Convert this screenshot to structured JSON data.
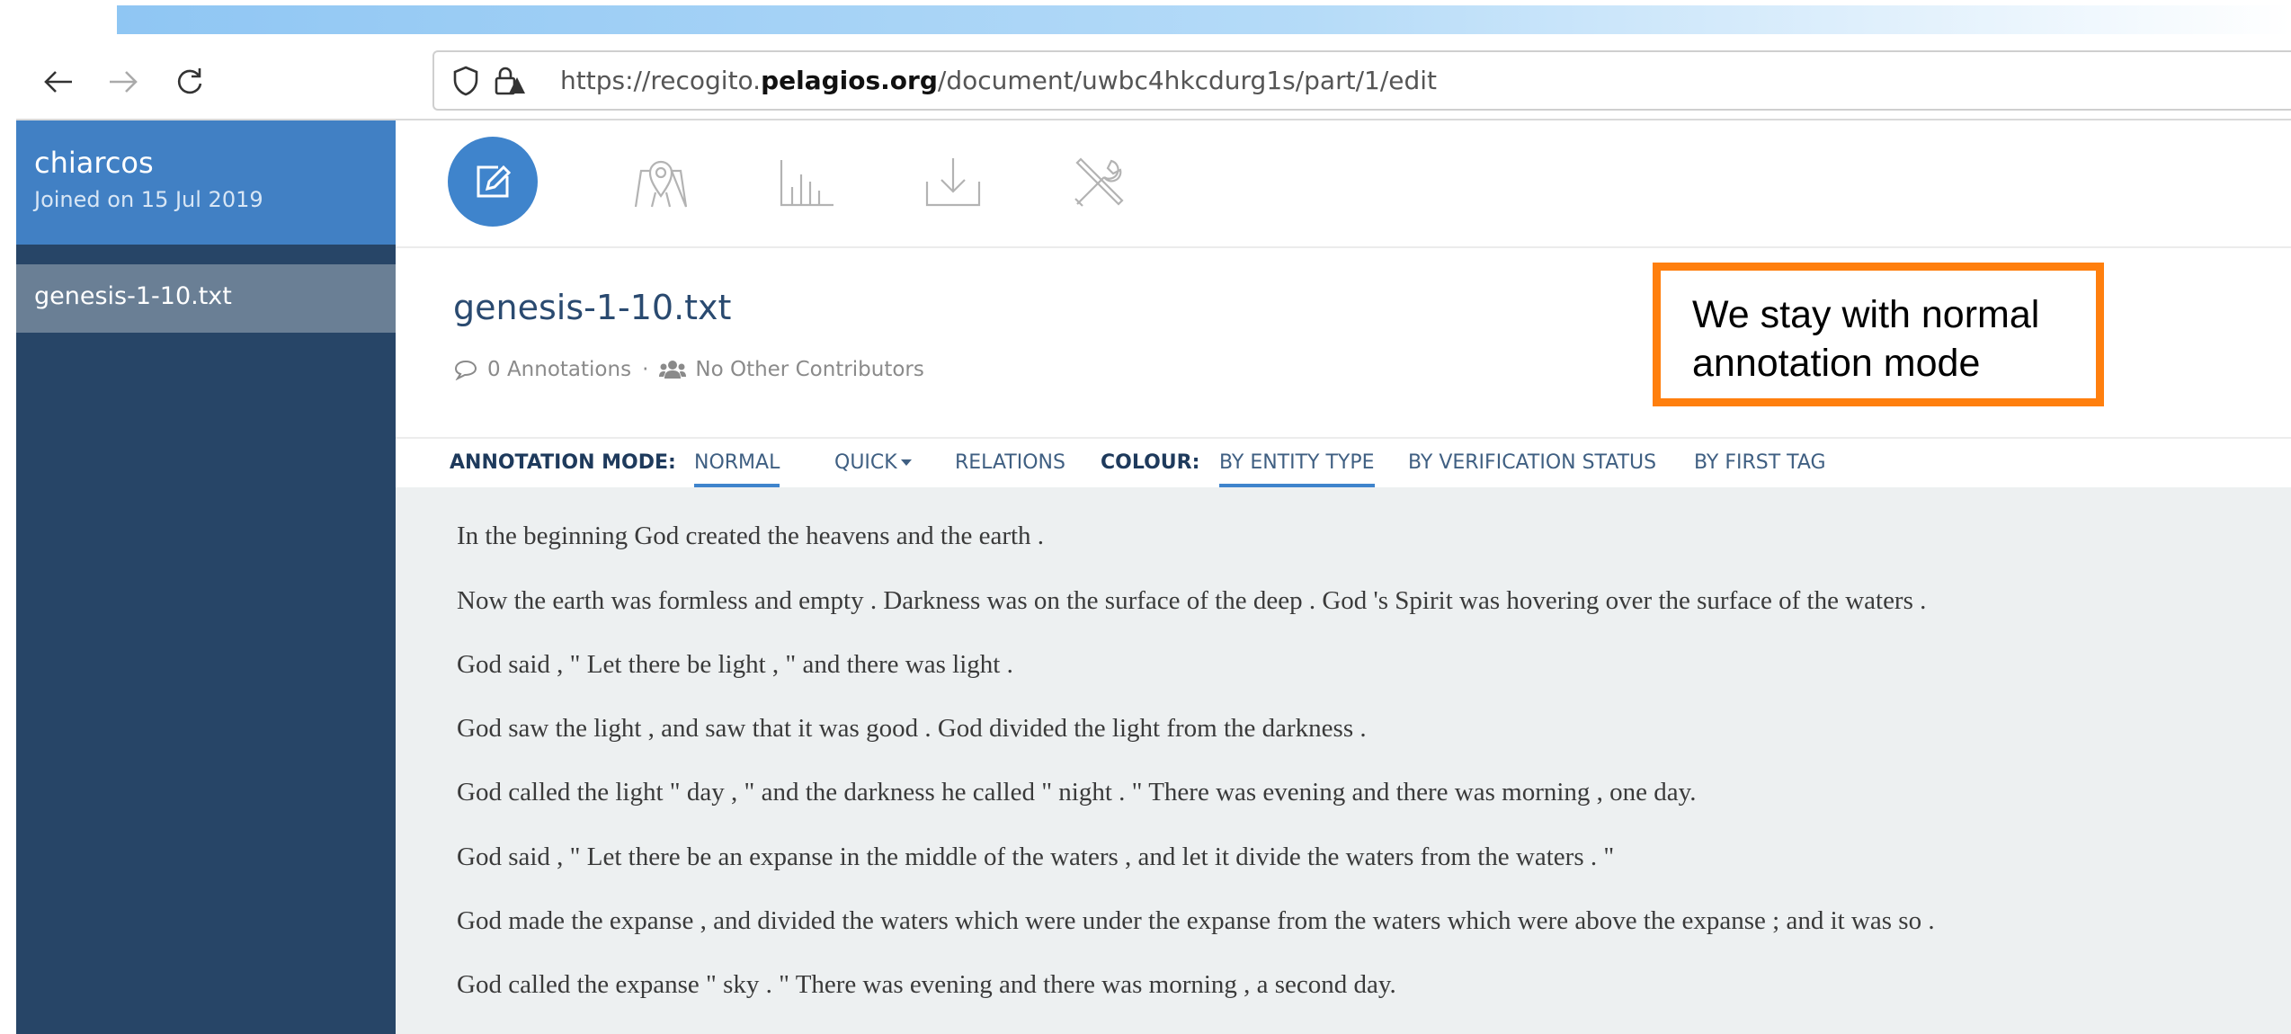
{
  "browser": {
    "url_prefix": "https://recogito.",
    "url_domain": "pelagios.org",
    "url_path": "/document/uwbc4hkcdurg1s/part/1/edit"
  },
  "sidebar": {
    "user_name": "chiarcos",
    "joined": "Joined on 15 Jul 2019",
    "document": "genesis-1-10.txt"
  },
  "toolbar": {
    "icons": [
      "edit-icon",
      "map-icon",
      "stats-icon",
      "download-icon",
      "settings-icon"
    ],
    "accent": "#3f84cc"
  },
  "document": {
    "title": "genesis-1-10.txt",
    "annotations": "0 Annotations",
    "separator": "·",
    "contributors": "No Other Contributors"
  },
  "modebar": {
    "mode_label": "ANNOTATION MODE:",
    "normal": "NORMAL",
    "quick": "QUICK",
    "relations": "RELATIONS",
    "colour_label": "COLOUR:",
    "by_entity": "BY ENTITY TYPE",
    "by_verification": "BY VERIFICATION STATUS",
    "by_first_tag": "BY FIRST TAG"
  },
  "text_lines": [
    "In the beginning God created the heavens and the earth .",
    "Now the earth was formless and empty . Darkness was on the surface of the deep . God 's Spirit was hovering over the surface of the waters .",
    "God said , \" Let there be light , \" and there was light .",
    "God saw the light , and saw that it was good . God divided the light from the darkness .",
    "God called the light \" day , \" and the darkness he called \" night . \" There was evening and there was morning , one day.",
    "God said , \" Let there be an expanse in the middle of the waters , and let it divide the waters from the waters . \"",
    "God made the expanse , and divided the waters which were under the expanse from the waters which were above the expanse ; and it was so .",
    "God called the expanse \" sky . \" There was evening and there was morning , a second day."
  ],
  "callout": {
    "text": "We stay with normal annotation mode",
    "border_color": "#ff7f0e"
  }
}
